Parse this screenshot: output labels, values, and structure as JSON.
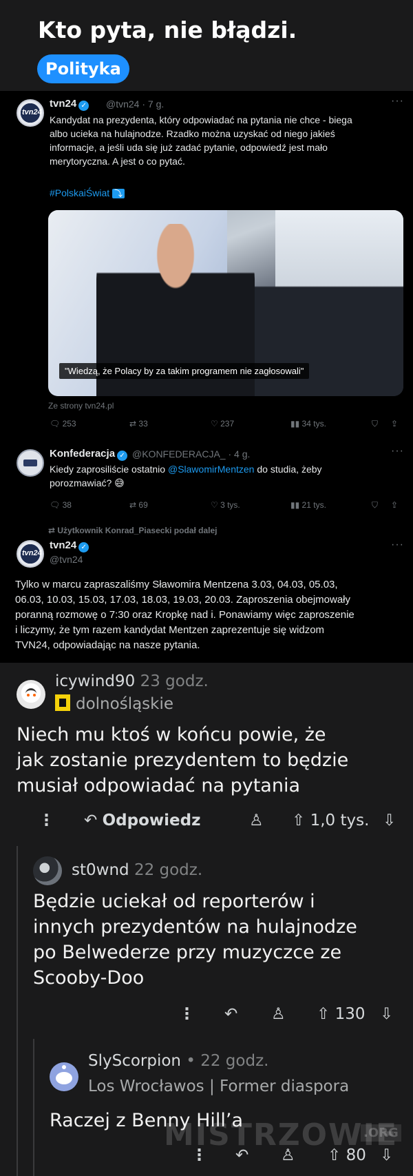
{
  "page": {
    "title": "Kto pyta, nie błądzi.",
    "tag": "Polityka"
  },
  "tweet1": {
    "name": "tvn24",
    "handle_time": "@tvn24 · 7 g.",
    "text_lines": [
      "Kandydat na prezydenta, który odpowiadać na pytania nie chce - biega",
      "albo ucieka na hulajnodze. Rzadko można uzyskać od niego jakieś",
      "informacje, a jeśli uda się już zadać pytanie, odpowiedź jest mało",
      "merytoryczna. A jest o co pytać."
    ],
    "hashtag": "#PolskaiŚwiat",
    "hashtag_emoji": "⤵",
    "photo_caption": "\"Wiedzą, że Polacy by za takim programem nie zagłosowali\"",
    "source": "Ze strony tvn24.pl",
    "replies": "253",
    "reposts": "33",
    "likes": "237",
    "views": "34 tys."
  },
  "tweet2": {
    "name": "Konfederacja",
    "handle_time": "@KONFEDERACJA_ · 4 g.",
    "text_before_mention": "Kiedy zaprosiliście ostatnio ",
    "mention": "@SlawomirMentzen",
    "text_after_mention": " do studia, żeby",
    "text_line2": "porozmawiać? 😅",
    "replies": "38",
    "reposts": "69",
    "likes": "3 tys.",
    "views": "21 tys."
  },
  "tweet3": {
    "repost_note": "Użytkownik Konrad_Piasecki podał dalej",
    "name": "tvn24",
    "handle": "@tvn24",
    "text_lines": [
      "Tylko w marcu zapraszaliśmy Sławomira Mentzena 3.03, 04.03, 05.03,",
      "06.03, 10.03, 15.03, 17.03, 18.03, 19.03, 20.03. Zaproszenia obejmowały",
      "poranną rozmowę o 7:30 oraz Kropkę nad i. Ponawiamy więc zaproszenie",
      "i liczymy, że tym razem kandydat Mentzen zaprezentuje się widzom",
      "TVN24, odpowiadając na nasze pytania."
    ]
  },
  "comment1": {
    "user": "icywind90",
    "time": "23 godz.",
    "flair": "dolnośląskie",
    "body_lines": [
      "Niech mu ktoś w końcu powie, że",
      "jak zostanie prezydentem to będzie",
      "musiał odpowiadać na pytania"
    ],
    "reply_label": "Odpowiedz",
    "votes": "1,0 tys."
  },
  "comment2": {
    "user": "st0wnd",
    "time": "22 godz.",
    "body_lines": [
      "Będzie uciekał od reporterów i",
      "innych prezydentów na hulajnodze",
      "po Belwederze przy muzyczce ze",
      "Scooby-Doo"
    ],
    "votes": "130"
  },
  "comment3": {
    "user": "SlyScorpion",
    "separator": "•",
    "time": "22 godz.",
    "flair": "Los Wrocławos | Former diaspora",
    "body": "Raczej z Benny Hill’a",
    "votes": "80"
  },
  "watermark": {
    "text": "MISTRZOWIE",
    "suffix": ".ORG"
  },
  "icons": [
    "more-dots-icon",
    "reply-arrow-icon",
    "award-icon",
    "upvote-icon",
    "downvote-icon",
    "repost-icon",
    "heart-icon",
    "views-icon",
    "bookmark-icon",
    "share-icon",
    "verified-icon"
  ],
  "colors": {
    "background": "#1a1a1b",
    "tag": "#1e90ff",
    "twitter_link": "#1d9bf0"
  }
}
